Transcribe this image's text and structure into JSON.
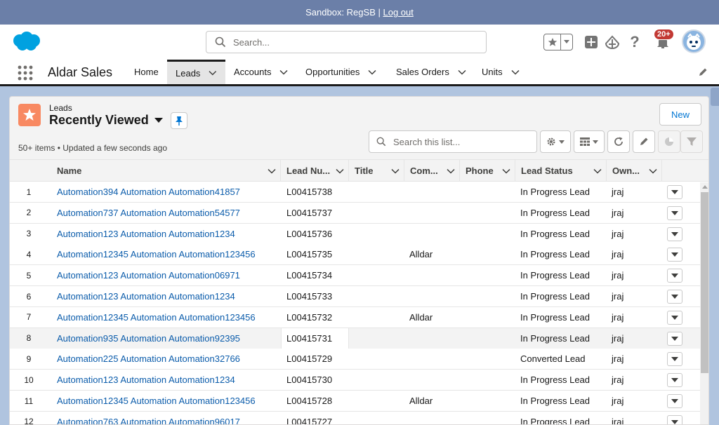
{
  "sandbox": {
    "text": "Sandbox: RegSB |",
    "logout": "Log out"
  },
  "header": {
    "search_placeholder": "Search...",
    "notifications_badge": "20+"
  },
  "nav": {
    "app_name": "Aldar Sales",
    "tabs": [
      {
        "label": "Home"
      },
      {
        "label": "Leads"
      },
      {
        "label": "Accounts"
      },
      {
        "label": "Opportunities"
      },
      {
        "label": "Sales Orders"
      },
      {
        "label": "Units"
      }
    ]
  },
  "list": {
    "object_label": "Leads",
    "view_name": "Recently Viewed",
    "info": "50+ items • Updated a few seconds ago",
    "new_button": "New",
    "search_placeholder": "Search this list...",
    "columns": [
      "Name",
      "Lead Nu...",
      "Title",
      "Com...",
      "Phone",
      "Lead Status",
      "Own..."
    ],
    "rows": [
      {
        "n": "1",
        "name": "Automation394 Automation Automation41857",
        "lead_number": "L00415738",
        "company": "",
        "status": "In Progress Lead",
        "owner": "jraj"
      },
      {
        "n": "2",
        "name": "Automation737 Automation Automation54577",
        "lead_number": "L00415737",
        "company": "",
        "status": "In Progress Lead",
        "owner": "jraj"
      },
      {
        "n": "3",
        "name": "Automation123 Automation Automation1234",
        "lead_number": "L00415736",
        "company": "",
        "status": "In Progress Lead",
        "owner": "jraj"
      },
      {
        "n": "4",
        "name": "Automation12345 Automation Automation123456",
        "lead_number": "L00415735",
        "company": "Alldar",
        "status": "In Progress Lead",
        "owner": "jraj"
      },
      {
        "n": "5",
        "name": "Automation123 Automation Automation06971",
        "lead_number": "L00415734",
        "company": "",
        "status": "In Progress Lead",
        "owner": "jraj"
      },
      {
        "n": "6",
        "name": "Automation123 Automation Automation1234",
        "lead_number": "L00415733",
        "company": "",
        "status": "In Progress Lead",
        "owner": "jraj"
      },
      {
        "n": "7",
        "name": "Automation12345 Automation Automation123456",
        "lead_number": "L00415732",
        "company": "Alldar",
        "status": "In Progress Lead",
        "owner": "jraj"
      },
      {
        "n": "8",
        "name": "Automation935 Automation Automation92395",
        "lead_number": "L00415731",
        "company": "",
        "status": "In Progress Lead",
        "owner": "jraj"
      },
      {
        "n": "9",
        "name": "Automation225 Automation Automation32766",
        "lead_number": "L00415729",
        "company": "",
        "status": "Converted Lead",
        "owner": "jraj"
      },
      {
        "n": "10",
        "name": "Automation123 Automation Automation1234",
        "lead_number": "L00415730",
        "company": "",
        "status": "In Progress Lead",
        "owner": "jraj"
      },
      {
        "n": "11",
        "name": "Automation12345 Automation Automation123456",
        "lead_number": "L00415728",
        "company": "Alldar",
        "status": "In Progress Lead",
        "owner": "jraj"
      },
      {
        "n": "12",
        "name": "Automation763 Automation Automation96017",
        "lead_number": "L00415727",
        "company": "",
        "status": "In Progress Lead",
        "owner": "jraj"
      }
    ]
  },
  "colors": {
    "brand": "#0176d3",
    "lead_icon": "#f88962",
    "badge": "#c23934",
    "link": "#0b5cab"
  }
}
